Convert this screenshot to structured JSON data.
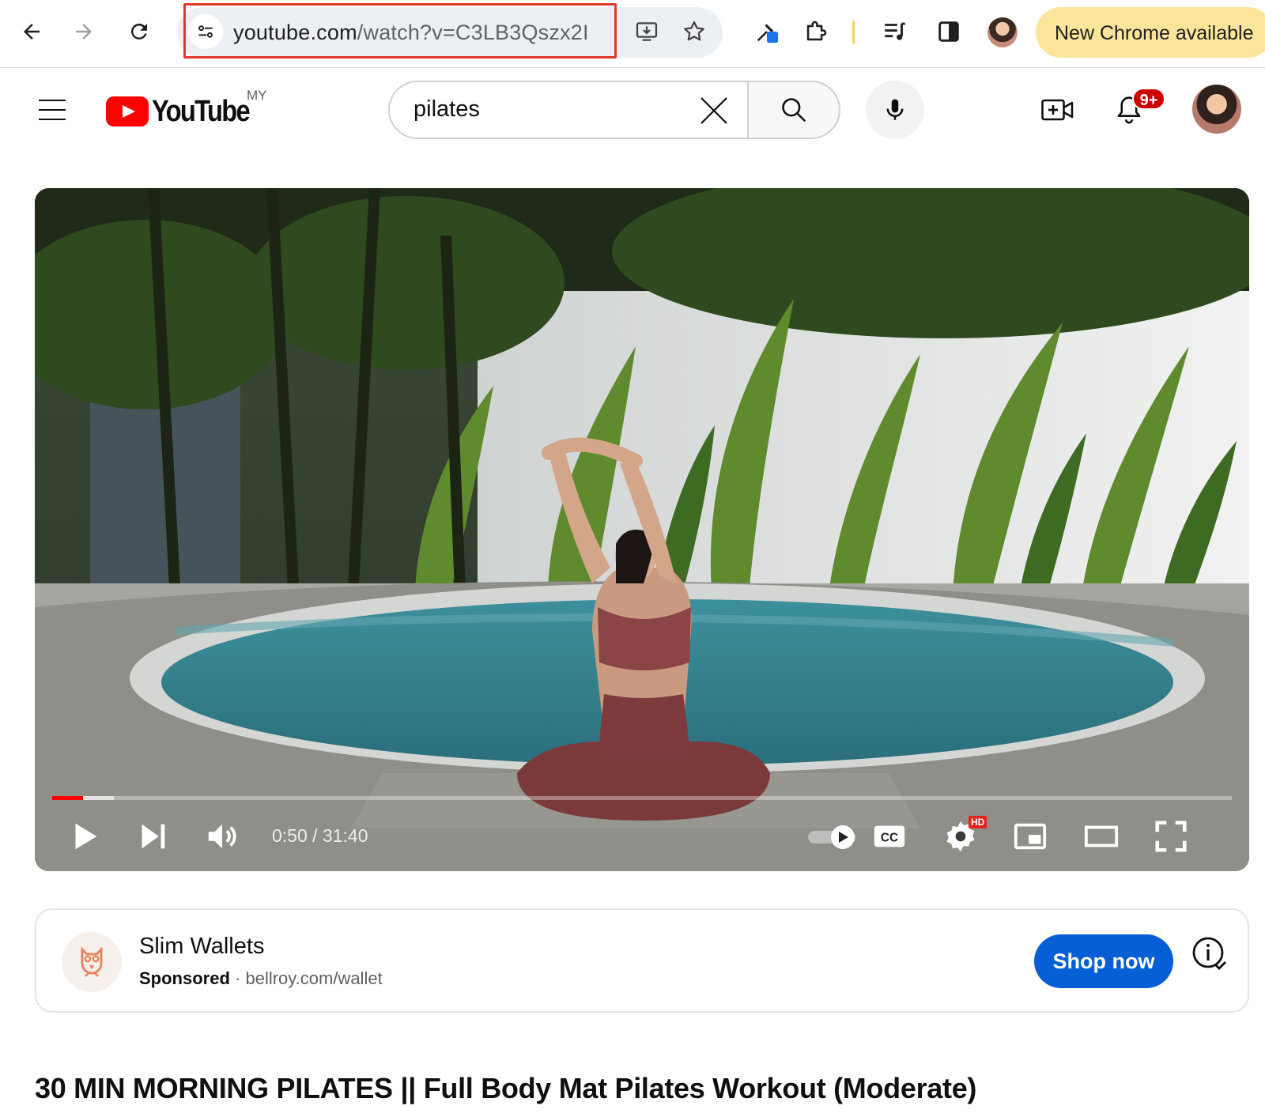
{
  "browser": {
    "url_host": "youtube.com",
    "url_path": "/watch?v=C3LB3Qszx2I",
    "update_label": "New Chrome available",
    "icons": [
      "back-icon",
      "forward-icon",
      "reload-icon",
      "tune-icon",
      "install-app-icon",
      "bookmark-star-icon",
      "eyedropper-extension-icon",
      "extensions-puzzle-icon",
      "reading-list-icon",
      "side-panel-icon",
      "profile-avatar"
    ]
  },
  "masthead": {
    "logo_text": "YouTube",
    "country_code": "MY",
    "search_value": "pilates",
    "notification_count": "9+",
    "icons": [
      "menu-icon",
      "clear-icon",
      "search-icon",
      "mic-icon",
      "create-video-icon",
      "bell-icon"
    ]
  },
  "player": {
    "time_text": "0:50 / 31:40",
    "played_fraction": 0.026,
    "buffered_fraction": 0.052,
    "hd_label": "HD",
    "cc_label": "CC",
    "icons": [
      "play-icon",
      "next-icon",
      "volume-icon",
      "autoplay-toggle",
      "captions-icon",
      "settings-gear-icon",
      "miniplayer-icon",
      "theater-mode-icon",
      "fullscreen-icon"
    ]
  },
  "ad": {
    "title": "Slim Wallets",
    "sponsored_label": "Sponsored",
    "separator": " · ",
    "domain": "bellroy.com/wallet",
    "cta_label": "Shop now",
    "icons": [
      "owl-logo-icon",
      "ad-info-icon"
    ]
  },
  "video": {
    "title": "30 MIN MORNING PILATES || Full Body Mat Pilates Workout (Moderate)"
  },
  "colors": {
    "accent_red": "#ff0000",
    "cta_blue": "#065fd4",
    "update_yellow": "#fbe59a",
    "badge_red": "#cc0000"
  }
}
